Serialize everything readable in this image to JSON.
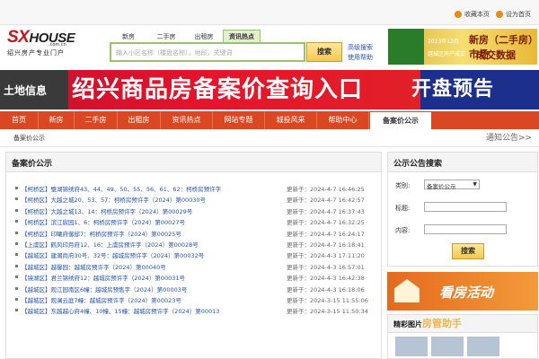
{
  "topbar": {
    "links": [
      "收藏本页",
      "设为首页"
    ]
  },
  "logo": {
    "brand_sx": "SX",
    "brand_house": "HOUSE",
    "domain": ".com.cn",
    "slogan": "绍兴房产专业门户"
  },
  "search": {
    "tabs": [
      "新房",
      "二手房",
      "出租房",
      "资讯热点"
    ],
    "active_tab": "资讯热点",
    "placeholder": "输入小区名称（楼盘名称），地段，关键词",
    "button": "搜索",
    "links": [
      "高级搜索",
      "使用帮助"
    ]
  },
  "ad_top": {
    "line1": "2023年12月",
    "line2": "越城区房产成交",
    "big1": "新房（二手房）市场",
    "big2": "成交数据"
  },
  "banner": {
    "left": "土地信息",
    "main": "绍兴商品房备案价查询入口",
    "right": "开盘预告"
  },
  "nav": {
    "items": [
      "首页",
      "新房",
      "二手房",
      "出租房",
      "资讯热点",
      "网站专题",
      "城投风采",
      "帮助中心",
      "备案价公示"
    ],
    "active": "备案价公示"
  },
  "breadcrumb": "备案价公示",
  "notice": "通知公告>>",
  "main_panel": {
    "title": "备案价公示",
    "rows": [
      {
        "title": "【柯桥区】璧湖锦绣府43、44、49、50、55、56、61、62：柯桥房预许字",
        "date": "更新于：2024-4-7 16:46:25"
      },
      {
        "title": "【柯桥区】大越之城20、53、57：柯桥房预许字（2024）第00030号",
        "date": "更新于：2024-4-7 16:42:57"
      },
      {
        "title": "【柯桥区】大越之城13、14：柯桥房预许字（2024）第00029号",
        "date": "更新于：2024-4-7 16:37:43"
      },
      {
        "title": "【柯桥区】滨江宸园1、6：柯桥房预许字（2024）第00027号",
        "date": "更新于：2024-4-7 16:32:25"
      },
      {
        "title": "【柯桥区】印曦府御邸7：柯桥房预许字（2024）第00025号",
        "date": "更新于：2024-4-7 16:24:17"
      },
      {
        "title": "【上虞区】鹤风印月府12、16：上虞房预许字（2024）第00028号",
        "date": "更新于：2024-4-7 16:18:41"
      },
      {
        "title": "【越城区】建潮尚府30号、32号：越城房预许字（2024）第00032号",
        "date": "更新于：2024-4-3 17:11:20"
      },
      {
        "title": "【越城区】越馨园：越城房预许字（2024）第00040号",
        "date": "更新于：2024-4-3 16:57:01"
      },
      {
        "title": "【镜湖区】君兰锦绣府12：越城房预许字（2024）第00031号",
        "date": "更新于：2024-4-3 16:42:38"
      },
      {
        "title": "【越城区】观江园南区6幢：越城房预售字（2024）第00003号",
        "date": "更新于：2024-4-3 16:18:06"
      },
      {
        "title": "【越城区】观澜云庭7幢：越城房预许字（2024）第00023号",
        "date": "更新于：2024-3-15 11:55:06"
      },
      {
        "title": "【越城区】东越越心府4幢、10幢、15幢：越城房预许字（2024）第00013",
        "date": "更新于：2024-3-15 11:50:34"
      }
    ]
  },
  "side_search": {
    "title": "公示公告搜索",
    "category_label": "类别:",
    "category_value": "备案价公示",
    "title_label": "标题:",
    "content_label": "内容:",
    "button": "搜索"
  },
  "ad_side": {
    "text": "看房活动"
  },
  "side_panel2": {
    "title": "精彩图片"
  },
  "watermark": "房管助手"
}
